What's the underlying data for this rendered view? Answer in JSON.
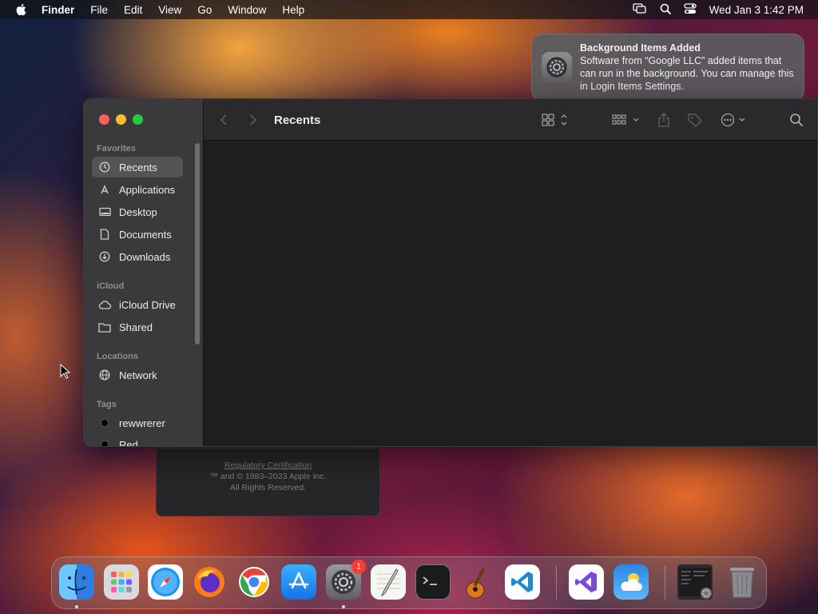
{
  "menubar": {
    "app_name": "Finder",
    "menus": [
      "File",
      "Edit",
      "View",
      "Go",
      "Window",
      "Help"
    ],
    "clock": "Wed Jan 3  1:42 PM"
  },
  "notification": {
    "title": "Background Items Added",
    "body": "Software from “Google LLC” added items that can run in the background. You can manage this in Login Items Settings.",
    "icon": "gear-icon"
  },
  "about_window": {
    "link": "Regulatory Certification",
    "line1": "™ and © 1983–2023 Apple Inc.",
    "line2": "All Rights Reserved."
  },
  "finder": {
    "title": "Recents",
    "sidebar": {
      "favorites_label": "Favorites",
      "favorites": [
        {
          "label": "Recents",
          "icon": "clock-icon"
        },
        {
          "label": "Applications",
          "icon": "applications-icon"
        },
        {
          "label": "Desktop",
          "icon": "desktop-icon"
        },
        {
          "label": "Documents",
          "icon": "document-icon"
        },
        {
          "label": "Downloads",
          "icon": "download-icon"
        }
      ],
      "icloud_label": "iCloud",
      "icloud": [
        {
          "label": "iCloud Drive",
          "icon": "cloud-icon"
        },
        {
          "label": "Shared",
          "icon": "shared-folder-icon"
        }
      ],
      "locations_label": "Locations",
      "locations": [
        {
          "label": "Network",
          "icon": "network-icon"
        }
      ],
      "tags_label": "Tags",
      "tags": [
        {
          "label": "rewwrerer",
          "color": "#000000"
        },
        {
          "label": "Red",
          "color": "#000000"
        }
      ]
    }
  },
  "dock": {
    "apps": [
      {
        "name": "Finder",
        "running": true
      },
      {
        "name": "Launchpad",
        "running": false
      },
      {
        "name": "Safari",
        "running": false
      },
      {
        "name": "Firefox",
        "running": false
      },
      {
        "name": "Chrome",
        "running": false
      },
      {
        "name": "App Store",
        "running": false
      },
      {
        "name": "System Settings",
        "running": true,
        "badge": "1"
      },
      {
        "name": "TextEdit",
        "running": false
      },
      {
        "name": "Terminal",
        "running": false
      },
      {
        "name": "GarageBand",
        "running": false
      },
      {
        "name": "Visual Studio Code",
        "running": false
      },
      {
        "name": "Visual Studio",
        "running": false
      },
      {
        "name": "Weather",
        "running": false
      },
      {
        "name": "Recent Window",
        "running": false
      },
      {
        "name": "Trash",
        "running": false
      }
    ]
  }
}
